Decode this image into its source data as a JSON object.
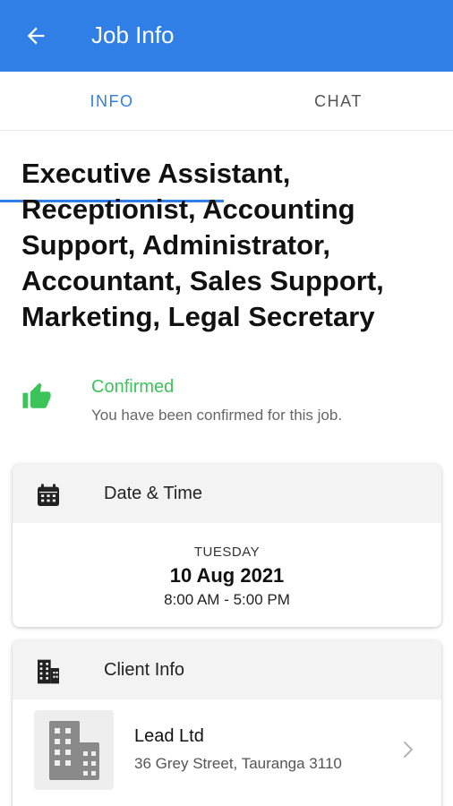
{
  "appbar": {
    "title": "Job Info",
    "back_icon": "arrow-left-icon",
    "color": "#2f7fe6"
  },
  "tabs": [
    {
      "label": "INFO",
      "active": true
    },
    {
      "label": "CHAT",
      "active": false
    }
  ],
  "job": {
    "title": "Executive Assistant, Receptionist, Accounting Support, Administrator, Accountant, Sales Support, Marketing, Legal Secretary"
  },
  "status": {
    "icon": "thumbs-up-icon",
    "label": "Confirmed",
    "description": "You have been confirmed for this job.",
    "color": "#3cc45a"
  },
  "datetime": {
    "icon": "calendar-icon",
    "heading": "Date & Time",
    "day": "TUESDAY",
    "date": "10 Aug 2021",
    "time": "8:00 AM - 5:00 PM"
  },
  "client": {
    "icon": "building-icon",
    "heading": "Client Info",
    "name": "Lead Ltd",
    "address": "36 Grey Street, Tauranga 3110"
  }
}
